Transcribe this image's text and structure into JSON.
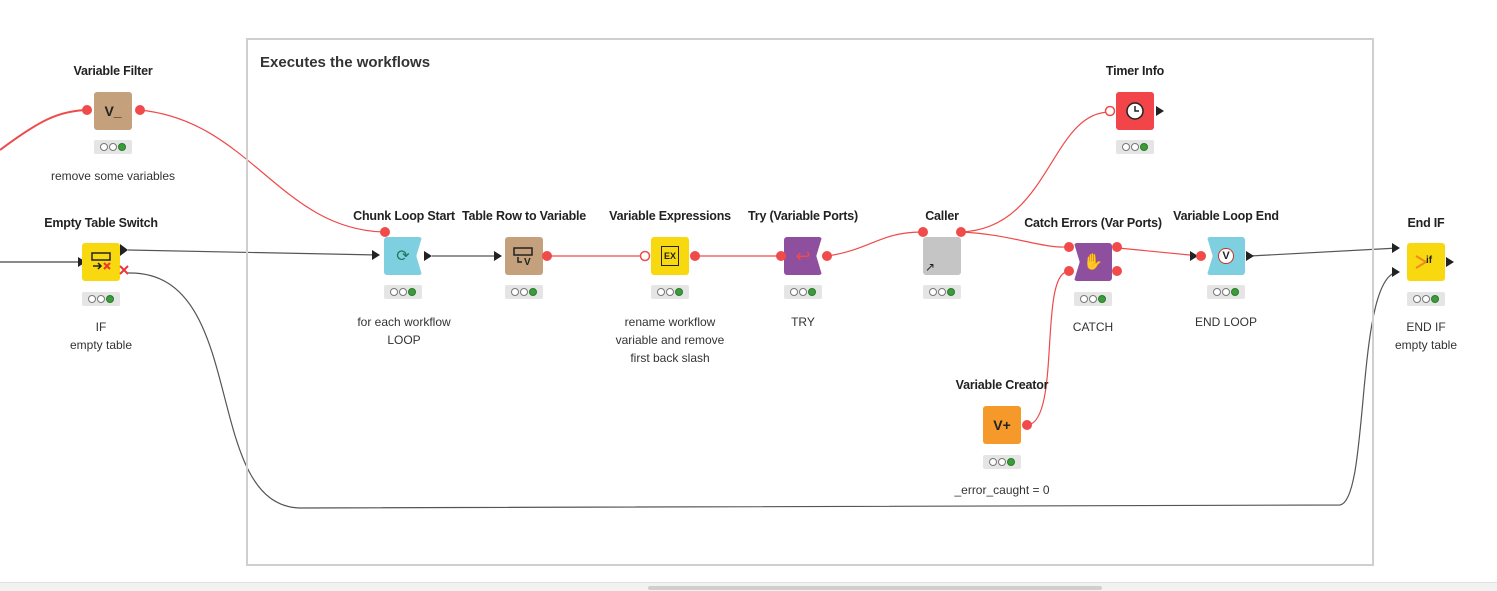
{
  "annotation": {
    "title": "Executes the workflows"
  },
  "nodes": [
    {
      "key": "variable_filter",
      "title": "Variable Filter",
      "label": [
        "remove some variables"
      ],
      "color": "#c4a07c",
      "icon": "variable-filter-icon",
      "status": "executed"
    },
    {
      "key": "empty_table_switch",
      "title": "Empty Table Switch",
      "label": [
        "IF",
        "empty table"
      ],
      "color": "#f8d90f",
      "icon": "empty-table-switch-icon",
      "status": "executed"
    },
    {
      "key": "chunk_loop_start",
      "title": "Chunk Loop Start",
      "label": [
        "for each workflow",
        "LOOP"
      ],
      "color": "#7ecfe0",
      "icon": "loop-start-icon",
      "status": "executed"
    },
    {
      "key": "table_row_to_variable",
      "title": "Table Row to Variable",
      "label": [],
      "color": "#c4a07c",
      "icon": "table-row-to-variable-icon",
      "status": "executed"
    },
    {
      "key": "variable_expressions",
      "title": "Variable Expressions",
      "label": [
        "rename workflow",
        "variable and remove",
        "first back slash"
      ],
      "color": "#f8d90f",
      "icon": "expression-icon",
      "status": "executed"
    },
    {
      "key": "try_variable_ports",
      "title": "Try (Variable Ports)",
      "label": [
        "TRY"
      ],
      "color": "#8e4f9e",
      "icon": "try-icon",
      "status": "executed"
    },
    {
      "key": "caller",
      "title": "Caller",
      "label": [],
      "color": "#c5c5c5",
      "icon": "component-arrow-icon",
      "status": "executed"
    },
    {
      "key": "timer_info",
      "title": "Timer Info",
      "label": [],
      "color": "#f1454a",
      "icon": "clock-icon",
      "status": "executed"
    },
    {
      "key": "catch_errors",
      "title": "Catch Errors (Var Ports)",
      "label": [
        "CATCH"
      ],
      "color": "#8e4f9e",
      "icon": "catch-icon",
      "status": "executed"
    },
    {
      "key": "variable_loop_end",
      "title": "Variable Loop End",
      "label": [
        "END LOOP"
      ],
      "color": "#7ecfe0",
      "icon": "loop-end-icon",
      "status": "executed"
    },
    {
      "key": "end_if",
      "title": "End IF",
      "label": [
        "END IF",
        "empty table"
      ],
      "color": "#f8d90f",
      "icon": "end-if-icon",
      "status": "executed"
    },
    {
      "key": "variable_creator",
      "title": "Variable Creator",
      "label": [
        "_error_caught = 0"
      ],
      "color": "#f59a2a",
      "icon": "variable-creator-icon",
      "status": "executed"
    }
  ],
  "icons": {
    "variable_filter": "V_",
    "table_row_to_variable": "V",
    "expression": "EX",
    "end_if": "if",
    "variable_creator": "V+",
    "loop_end": "V"
  },
  "colors": {
    "flow_variable_connection": "#ef4a4a",
    "data_connection": "#555555",
    "port_variable": "#f04a4a"
  }
}
